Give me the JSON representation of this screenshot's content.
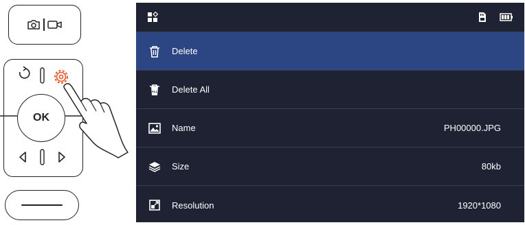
{
  "device": {
    "ok_label": "OK"
  },
  "screen": {
    "menu": [
      {
        "label": "Delete",
        "value": "",
        "icon": "trash-icon",
        "selected": true
      },
      {
        "label": "Delete All",
        "value": "",
        "icon": "trash-all-icon",
        "selected": false
      },
      {
        "label": "Name",
        "value": "PH00000.JPG",
        "icon": "image-icon",
        "selected": false
      },
      {
        "label": "Size",
        "value": "80kb",
        "icon": "layers-icon",
        "selected": false
      },
      {
        "label": "Resolution",
        "value": "1920*1080",
        "icon": "resolution-icon",
        "selected": false
      }
    ]
  },
  "colors": {
    "screen_bg": "#1e2233",
    "selected_row": "#2c4583",
    "settings_accent": "#e8562a"
  }
}
